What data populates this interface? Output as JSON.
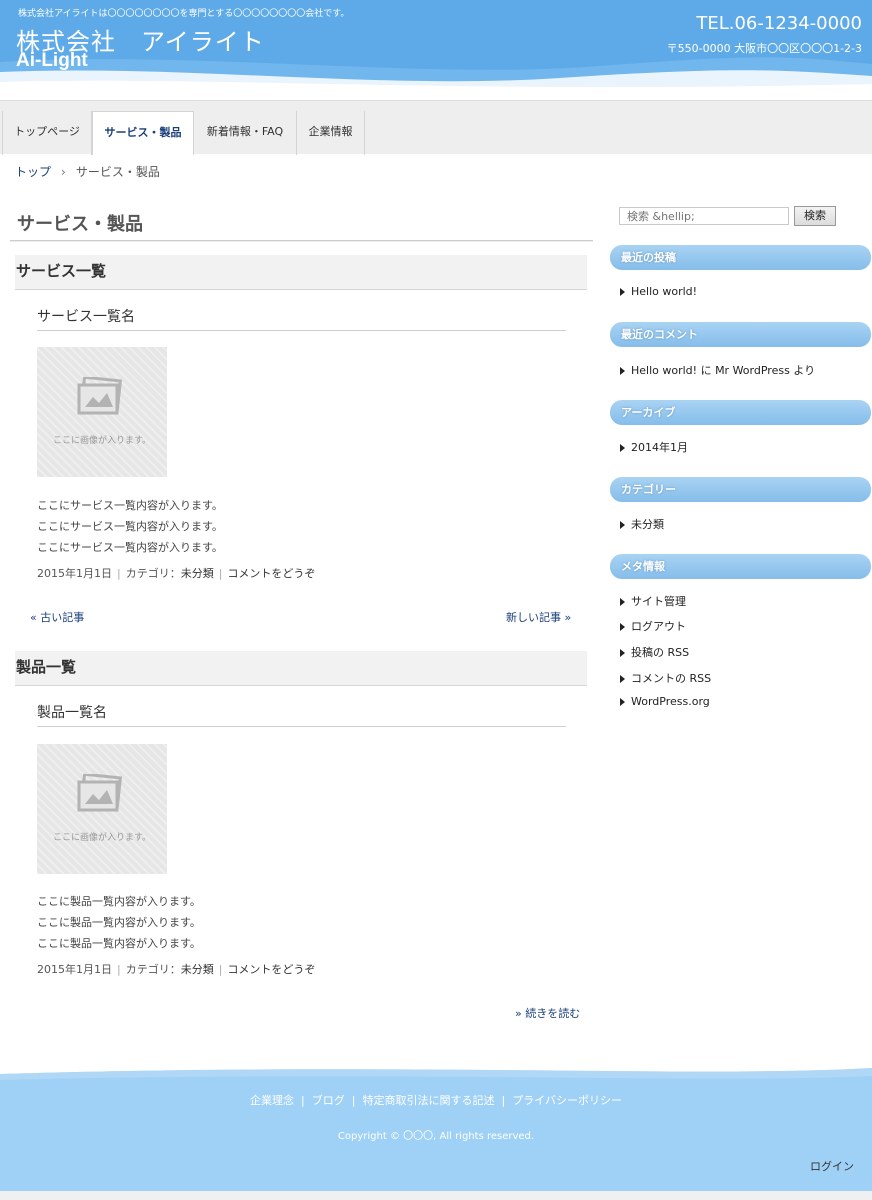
{
  "header": {
    "tagline": "株式会社アイライトは〇〇〇〇〇〇〇〇を専門とする〇〇〇〇〇〇〇〇会社です。",
    "company_name": "株式会社　アイライト",
    "brand": "Ai-Light",
    "tel": "TEL.06-1234-0000",
    "address": "〒550-0000 大阪市〇〇区〇〇〇1-2-3"
  },
  "nav": {
    "items": [
      {
        "label": "トップページ"
      },
      {
        "label": "サービス・製品"
      },
      {
        "label": "新着情報・FAQ"
      },
      {
        "label": "企業情報"
      }
    ],
    "active_index": 1
  },
  "breadcrumb": {
    "home": "トップ",
    "separator": "›",
    "current": "サービス・製品"
  },
  "main": {
    "page_title": "サービス・製品",
    "sections": [
      {
        "heading": "サービス一覧",
        "post_title": "サービス一覧名",
        "thumb_text": "ここに画像が入ります。",
        "lines": [
          "ここにサービス一覧内容が入ります。",
          "ここにサービス一覧内容が入ります。",
          "ここにサービス一覧内容が入ります。"
        ],
        "date": "2015年1月1日",
        "category_label": "カテゴリ：",
        "category": "未分類",
        "comment": "コメントをどうぞ"
      },
      {
        "heading": "製品一覧",
        "post_title": "製品一覧名",
        "thumb_text": "ここに画像が入ります。",
        "lines": [
          "ここに製品一覧内容が入ります。",
          "ここに製品一覧内容が入ります。",
          "ここに製品一覧内容が入ります。"
        ],
        "date": "2015年1月1日",
        "category_label": "カテゴリ：",
        "category": "未分類",
        "comment": "コメントをどうぞ"
      }
    ],
    "pager": {
      "older": "« 古い記事",
      "newer": "新しい記事 »"
    },
    "read_more": "» 続きを読む"
  },
  "sidebar": {
    "search_placeholder": "検索 &hellip;",
    "search_button": "検索",
    "widgets": [
      {
        "title": "最近の投稿",
        "items": [
          "Hello world!"
        ]
      },
      {
        "title": "最近のコメント",
        "items": [
          "Hello world! に Mr WordPress より"
        ]
      },
      {
        "title": "アーカイブ",
        "items": [
          "2014年1月"
        ]
      },
      {
        "title": "カテゴリー",
        "items": [
          "未分類"
        ]
      },
      {
        "title": "メタ情報",
        "items": [
          "サイト管理",
          "ログアウト",
          "投稿の RSS",
          "コメントの RSS",
          "WordPress.org"
        ]
      }
    ]
  },
  "footer": {
    "links": [
      "企業理念",
      "ブログ",
      "特定商取引法に関する記述",
      "プライバシーポリシー"
    ],
    "link_separator": "|",
    "copyright": "Copyright © 〇〇〇, All rights reserved.",
    "login": "ログイン"
  },
  "colors": {
    "header_bg": "#5eaae8",
    "footer_bg": "#9fd0f5",
    "link": "#1a3f7a",
    "widget_head": "#8fc3ec"
  }
}
